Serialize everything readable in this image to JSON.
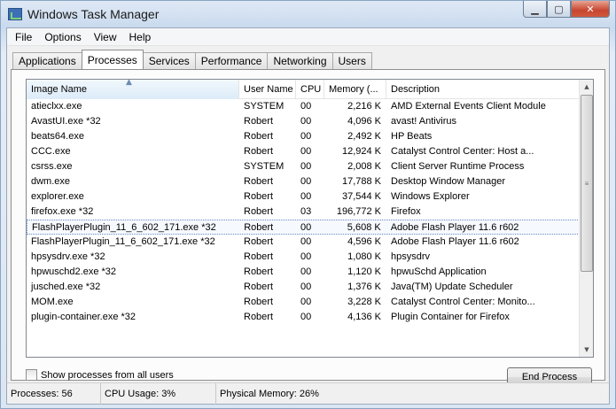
{
  "window": {
    "title": "Windows Task Manager",
    "minimize": "▁",
    "maximize": "▢",
    "close": "✕"
  },
  "menu": [
    {
      "label": "File"
    },
    {
      "label": "Options"
    },
    {
      "label": "View"
    },
    {
      "label": "Help"
    }
  ],
  "tabs": [
    {
      "label": "Applications",
      "active": false
    },
    {
      "label": "Processes",
      "active": true
    },
    {
      "label": "Services",
      "active": false
    },
    {
      "label": "Performance",
      "active": false
    },
    {
      "label": "Networking",
      "active": false
    },
    {
      "label": "Users",
      "active": false
    }
  ],
  "columns": [
    "Image Name",
    "User Name",
    "CPU",
    "Memory (...",
    "Description"
  ],
  "sort_arrow": "▲",
  "processes": [
    {
      "name": "atieclxx.exe",
      "user": "SYSTEM",
      "cpu": "00",
      "mem": "2,216 K",
      "desc": "AMD External Events Client Module",
      "selected": false
    },
    {
      "name": "AvastUI.exe *32",
      "user": "Robert",
      "cpu": "00",
      "mem": "4,096 K",
      "desc": "avast! Antivirus",
      "selected": false
    },
    {
      "name": "beats64.exe",
      "user": "Robert",
      "cpu": "00",
      "mem": "2,492 K",
      "desc": "HP Beats",
      "selected": false
    },
    {
      "name": "CCC.exe",
      "user": "Robert",
      "cpu": "00",
      "mem": "12,924 K",
      "desc": "Catalyst Control Center: Host a...",
      "selected": false
    },
    {
      "name": "csrss.exe",
      "user": "SYSTEM",
      "cpu": "00",
      "mem": "2,008 K",
      "desc": "Client Server Runtime Process",
      "selected": false
    },
    {
      "name": "dwm.exe",
      "user": "Robert",
      "cpu": "00",
      "mem": "17,788 K",
      "desc": "Desktop Window Manager",
      "selected": false
    },
    {
      "name": "explorer.exe",
      "user": "Robert",
      "cpu": "00",
      "mem": "37,544 K",
      "desc": "Windows Explorer",
      "selected": false
    },
    {
      "name": "firefox.exe *32",
      "user": "Robert",
      "cpu": "03",
      "mem": "196,772 K",
      "desc": "Firefox",
      "selected": false
    },
    {
      "name": "FlashPlayerPlugin_11_6_602_171.exe *32",
      "user": "Robert",
      "cpu": "00",
      "mem": "5,608 K",
      "desc": "Adobe Flash Player 11.6 r602",
      "selected": true
    },
    {
      "name": "FlashPlayerPlugin_11_6_602_171.exe *32",
      "user": "Robert",
      "cpu": "00",
      "mem": "4,596 K",
      "desc": "Adobe Flash Player 11.6 r602",
      "selected": false
    },
    {
      "name": "hpsysdrv.exe *32",
      "user": "Robert",
      "cpu": "00",
      "mem": "1,080 K",
      "desc": "hpsysdrv",
      "selected": false
    },
    {
      "name": "hpwuschd2.exe *32",
      "user": "Robert",
      "cpu": "00",
      "mem": "1,120 K",
      "desc": "hpwuSchd Application",
      "selected": false
    },
    {
      "name": "jusched.exe *32",
      "user": "Robert",
      "cpu": "00",
      "mem": "1,376 K",
      "desc": "Java(TM) Update Scheduler",
      "selected": false
    },
    {
      "name": "MOM.exe",
      "user": "Robert",
      "cpu": "00",
      "mem": "3,228 K",
      "desc": "Catalyst Control Center: Monito...",
      "selected": false
    },
    {
      "name": "plugin-container.exe *32",
      "user": "Robert",
      "cpu": "00",
      "mem": "4,136 K",
      "desc": "Plugin Container for Firefox",
      "selected": false
    }
  ],
  "scrollbar": {
    "up": "▲",
    "down": "▼",
    "grip": "≡"
  },
  "show_all_label": "Show processes from all users",
  "show_all_checked": false,
  "end_process_label": "End Process",
  "status": {
    "processes": "Processes: 56",
    "cpu": "CPU Usage: 3%",
    "memory": "Physical Memory: 26%"
  }
}
